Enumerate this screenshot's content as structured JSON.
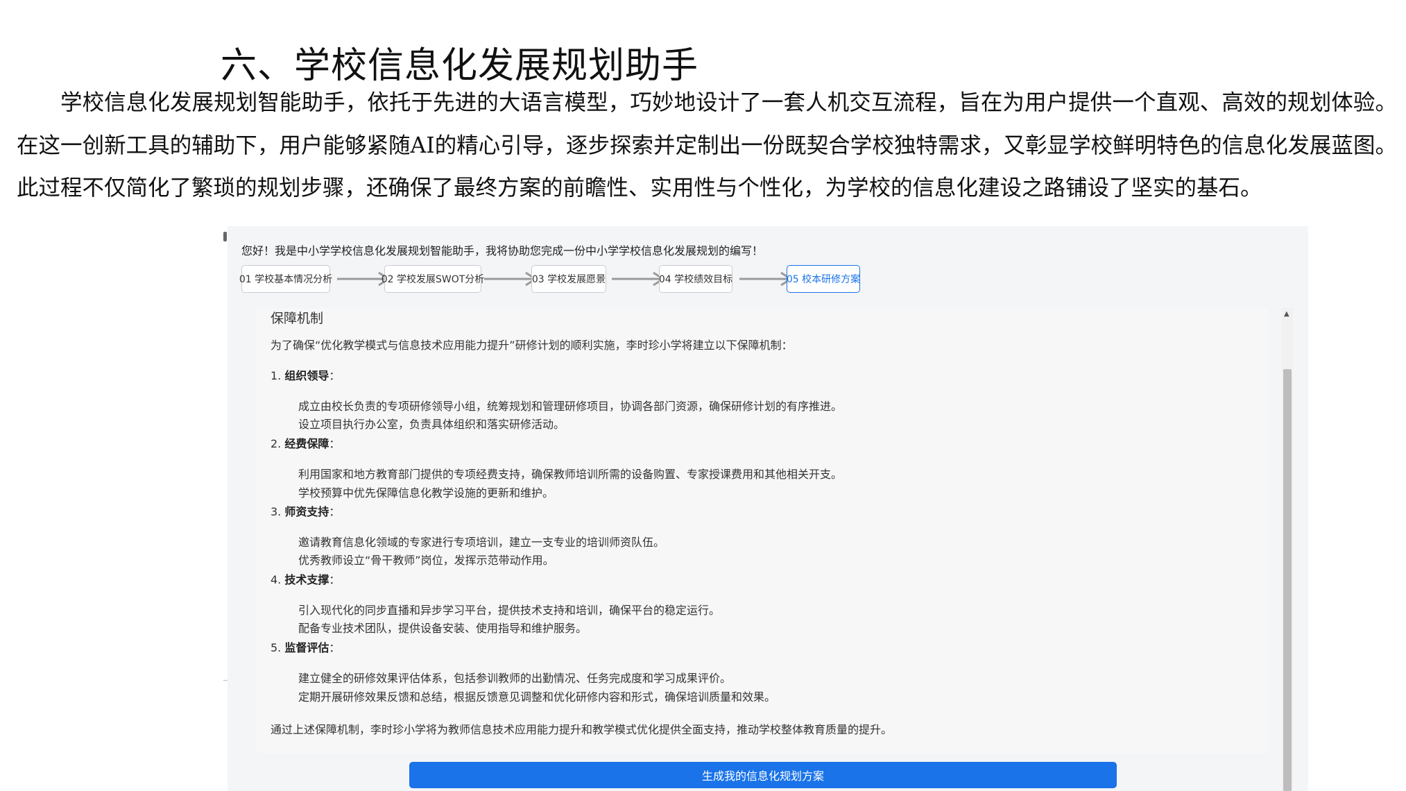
{
  "title": "六、学校信息化发展规划助手",
  "paragraph": "学校信息化发展规划智能助手，依托于先进的大语言模型，巧妙地设计了一套人机交互流程，旨在为用户提供一个直观、高效的规划体验。在这一创新工具的辅助下，用户能够紧随AI的精心引导，逐步探索并定制出一份既契合学校独特需求，又彰显学校鲜明特色的信息化发展蓝图。此过程不仅简化了繁琐的规划步骤，还确保了最终方案的前瞻性、实用性与个性化，为学校的信息化建设之路铺设了坚实的基石。",
  "screenshot": {
    "greeting": "您好！我是中小学学校信息化发展规划智能助手，我将协助您完成一份中小学学校信息化发展规划的编写！",
    "steps": [
      {
        "label": "01 学校基本情况分析",
        "active": false
      },
      {
        "label": "02 学校发展SWOT分析",
        "active": false
      },
      {
        "label": "03 学校发展愿景",
        "active": false
      },
      {
        "label": "04 学校绩效目标",
        "active": false
      },
      {
        "label": "05 校本研修方案",
        "active": true
      }
    ],
    "section_title": "保障机制",
    "intro": "为了确保“优化教学模式与信息技术应用能力提升”研修计划的顺利实施，李时珍小学将建立以下保障机制：",
    "items": [
      {
        "number": "1.",
        "title": "组织领导",
        "colon": "：",
        "lines": [
          "成立由校长负责的专项研修领导小组，统筹规划和管理研修项目，协调各部门资源，确保研修计划的有序推进。",
          "设立项目执行办公室，负责具体组织和落实研修活动。"
        ]
      },
      {
        "number": "2.",
        "title": "经费保障",
        "colon": "：",
        "lines": [
          "利用国家和地方教育部门提供的专项经费支持，确保教师培训所需的设备购置、专家授课费用和其他相关开支。",
          "学校预算中优先保障信息化教学设施的更新和维护。"
        ]
      },
      {
        "number": "3.",
        "title": "师资支持",
        "colon": "：",
        "lines": [
          "邀请教育信息化领域的专家进行专项培训，建立一支专业的培训师资队伍。",
          "优秀教师设立“骨干教师”岗位，发挥示范带动作用。"
        ]
      },
      {
        "number": "4.",
        "title": "技术支撑",
        "colon": "：",
        "lines": [
          "引入现代化的同步直播和异步学习平台，提供技术支持和培训，确保平台的稳定运行。",
          "配备专业技术团队，提供设备安装、使用指导和维护服务。"
        ]
      },
      {
        "number": "5.",
        "title": "监督评估",
        "colon": "：",
        "lines": [
          "建立健全的研修效果评估体系，包括参训教师的出勤情况、任务完成度和学习成果评价。",
          "定期开展研修效果反馈和总结，根据反馈意见调整和优化研修内容和形式，确保培训质量和效果。"
        ]
      }
    ],
    "conclusion": "通过上述保障机制，李时珍小学将为教师信息技术应用能力提升和教学模式优化提供全面支持，推动学校整体教育质量的提升。",
    "generate_button": "生成我的信息化规划方案"
  },
  "colors": {
    "accent": "#1a73e8",
    "panel_bg": "#f4f5f7",
    "content_bg": "#f7f7f8"
  }
}
